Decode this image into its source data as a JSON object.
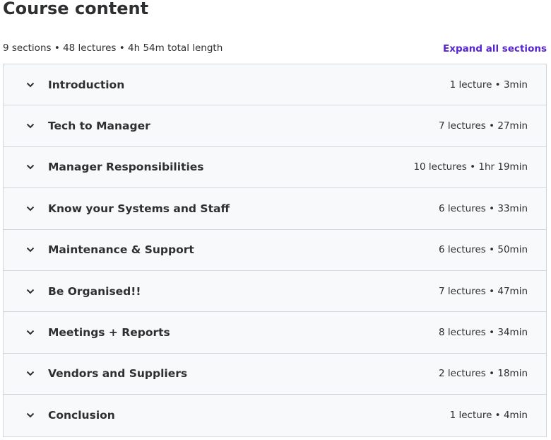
{
  "header": {
    "title": "Course content",
    "summary": "9 sections • 48 lectures • 4h 54m total length",
    "expand_all_label": "Expand all sections"
  },
  "colors": {
    "accent": "#5624d0",
    "row_background": "#f7f9fa",
    "border": "#d1d7dc",
    "text": "#2d2f31"
  },
  "sections": [
    {
      "title": "Introduction",
      "meta": "1 lecture • 3min",
      "icon": "chevron-down-icon"
    },
    {
      "title": "Tech to Manager",
      "meta": "7 lectures • 27min",
      "icon": "chevron-down-icon"
    },
    {
      "title": "Manager Responsibilities",
      "meta": "10 lectures • 1hr 19min",
      "icon": "chevron-down-icon"
    },
    {
      "title": "Know your Systems and Staff",
      "meta": "6 lectures • 33min",
      "icon": "chevron-down-icon"
    },
    {
      "title": "Maintenance & Support",
      "meta": "6 lectures • 50min",
      "icon": "chevron-down-icon"
    },
    {
      "title": "Be Organised!!",
      "meta": "7 lectures • 47min",
      "icon": "chevron-down-icon"
    },
    {
      "title": "Meetings + Reports",
      "meta": "8 lectures • 34min",
      "icon": "chevron-down-icon"
    },
    {
      "title": "Vendors and Suppliers",
      "meta": "2 lectures • 18min",
      "icon": "chevron-down-icon"
    },
    {
      "title": "Conclusion",
      "meta": "1 lecture • 4min",
      "icon": "chevron-down-icon"
    }
  ]
}
